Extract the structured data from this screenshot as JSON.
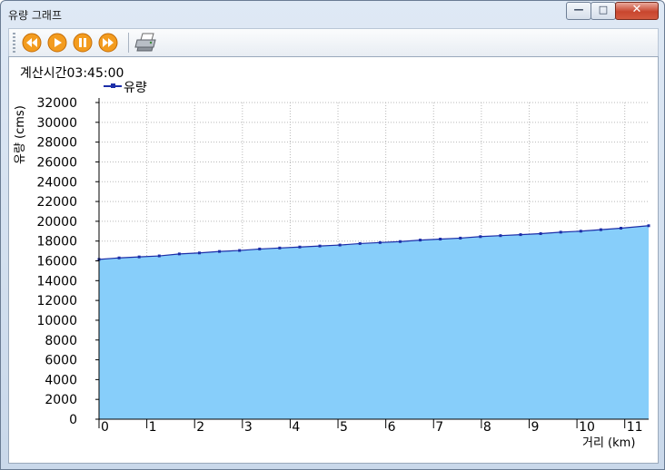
{
  "window": {
    "title": "유량 그래프",
    "controls": {
      "minimize": "—",
      "maximize": "□",
      "close": "✕"
    }
  },
  "toolbar": {
    "buttons": [
      {
        "name": "rewind-button",
        "icon": "rewind-icon"
      },
      {
        "name": "play-button",
        "icon": "play-icon"
      },
      {
        "name": "pause-button",
        "icon": "pause-icon"
      },
      {
        "name": "fast-forward-button",
        "icon": "fast-forward-icon"
      },
      {
        "name": "print-button",
        "icon": "printer-icon"
      }
    ],
    "accent_color": "#f39c1f"
  },
  "header": {
    "calc_time": "계산시간03:45:00"
  },
  "chart_data": {
    "type": "area",
    "legend": [
      "유량"
    ],
    "xlabel": "거리 (km)",
    "ylabel": "유량 (cms)",
    "xlim": [
      0,
      11.5
    ],
    "ylim": [
      0,
      32000
    ],
    "x_ticks": [
      0,
      1,
      2,
      3,
      4,
      5,
      6,
      7,
      8,
      9,
      10,
      11
    ],
    "y_ticks": [
      0,
      2000,
      4000,
      6000,
      8000,
      10000,
      12000,
      14000,
      16000,
      18000,
      20000,
      22000,
      24000,
      26000,
      28000,
      30000,
      32000
    ],
    "grid": true,
    "line_color": "#1c2ea8",
    "fill_color": "#87cefa",
    "series": [
      {
        "name": "유량",
        "x": [
          0,
          0.42,
          0.84,
          1.26,
          1.68,
          2.1,
          2.52,
          2.94,
          3.36,
          3.78,
          4.2,
          4.62,
          5.04,
          5.46,
          5.88,
          6.3,
          6.72,
          7.14,
          7.56,
          7.98,
          8.4,
          8.82,
          9.24,
          9.66,
          10.08,
          10.5,
          10.92,
          11.5
        ],
        "values": [
          16150,
          16300,
          16400,
          16500,
          16700,
          16800,
          16950,
          17050,
          17200,
          17300,
          17400,
          17500,
          17600,
          17750,
          17850,
          17950,
          18100,
          18200,
          18300,
          18450,
          18550,
          18650,
          18750,
          18900,
          19000,
          19150,
          19300,
          19550
        ]
      }
    ]
  }
}
